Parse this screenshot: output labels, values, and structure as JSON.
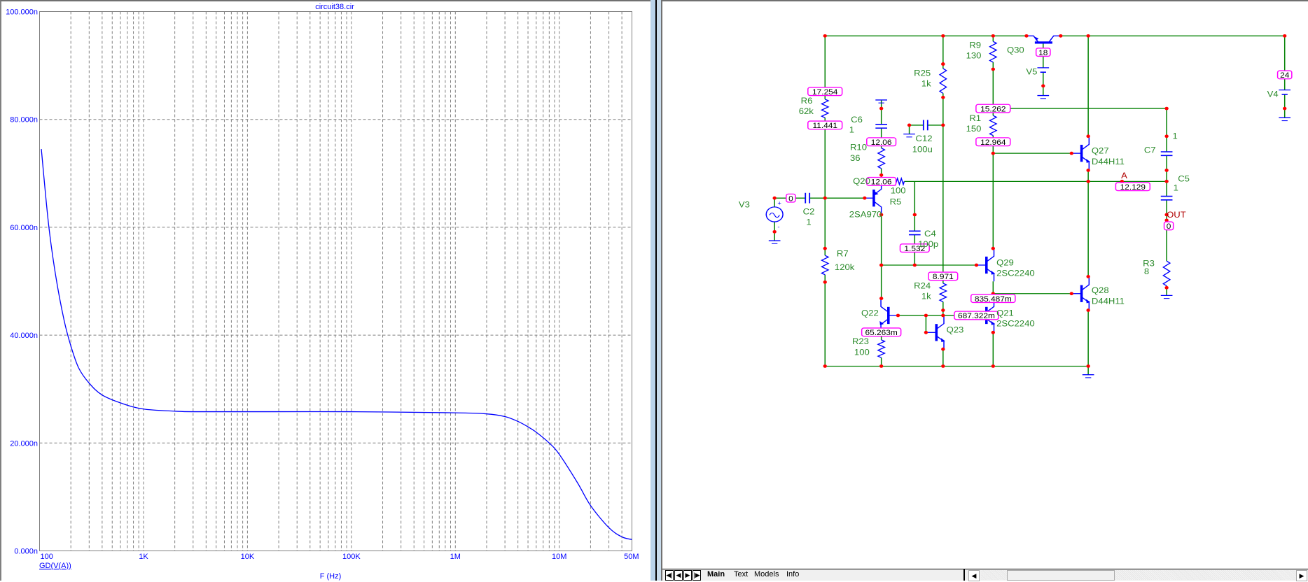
{
  "plot": {
    "title": "circuit38.cir",
    "trace_label": "GD(V(A))",
    "colors": {
      "trace": "#0000ff",
      "grid": "#808080",
      "text": "#0000ff"
    }
  },
  "chart_data": {
    "type": "line",
    "title": "circuit38.cir",
    "xlabel": "F (Hz)",
    "ylabel": "",
    "xscale": "log",
    "xlim": [
      100,
      50000000
    ],
    "ylim": [
      0,
      100
    ],
    "grid": true,
    "x_tick_labels": [
      "100",
      "1K",
      "10K",
      "100K",
      "1M",
      "10M",
      "50M"
    ],
    "x_ticks": [
      100,
      1000,
      10000,
      100000,
      1000000,
      10000000,
      50000000
    ],
    "y_tick_labels": [
      "0.000n",
      "20.000n",
      "40.000n",
      "60.000n",
      "80.000n",
      "100.000n"
    ],
    "y_ticks": [
      0,
      20,
      40,
      60,
      80,
      100
    ],
    "series": [
      {
        "name": "GD(V(A))",
        "x": [
          104,
          122,
          143,
          172,
          200,
          238,
          300,
          400,
          630,
          1000,
          2000,
          3000,
          10000,
          100000,
          1000000,
          2000000,
          3000000,
          4000000,
          5000000,
          6000000,
          8000000,
          10000000,
          15000000,
          20000000,
          30000000,
          40000000,
          50000000
        ],
        "y": [
          74.5,
          60.6,
          51.0,
          42.8,
          38.0,
          33.9,
          31.1,
          28.9,
          27.3,
          26.3,
          25.9,
          25.8,
          25.8,
          25.8,
          25.6,
          25.4,
          24.9,
          24.0,
          23.0,
          22.0,
          20.0,
          17.9,
          12.6,
          8.4,
          4.3,
          2.6,
          2.1
        ]
      }
    ]
  },
  "schematic": {
    "colors": {
      "wire": "#008000",
      "component": "#0000ff",
      "node": "#ff0000",
      "label": "#2a8a2a",
      "probe_label": "#b00000",
      "box_border": "#ff00ff"
    },
    "labels": [
      "R6",
      "62k",
      "C6",
      "1",
      "R10",
      "36",
      "Q20",
      "100",
      "R5",
      "2SA970",
      "V3",
      "C2",
      "1",
      "R7",
      "120k",
      "R25",
      "1k",
      "C12",
      "100u",
      "C4",
      "100p",
      "R24",
      "1k",
      "Q22",
      "R23",
      "100",
      "Q23",
      "R9",
      "130",
      "Q30",
      "V5",
      "R1",
      "150",
      "Q27",
      "D44H11",
      "Q29",
      "2SC2240",
      "Q21",
      "2SC2240",
      "Q28",
      "D44H11",
      "C7",
      "1",
      "C5",
      "1",
      "R3",
      "8",
      "V4"
    ],
    "probe_labels": [
      "A",
      "OUT"
    ],
    "source_signs": [
      "+",
      "-"
    ],
    "node_values": [
      "17.254",
      "11.441",
      "12.06",
      "12.06",
      "0",
      "1.532",
      "8.971",
      "15.262",
      "12.964",
      "18",
      "24",
      "12.129",
      "0",
      "835.487m",
      "687.322m",
      "65.263m"
    ]
  },
  "tabs": {
    "items": [
      "Main",
      "Text",
      "Models",
      "Info"
    ],
    "active": "Main",
    "nav_icons": [
      "first-icon",
      "prev-icon",
      "next-icon",
      "last-icon"
    ]
  }
}
